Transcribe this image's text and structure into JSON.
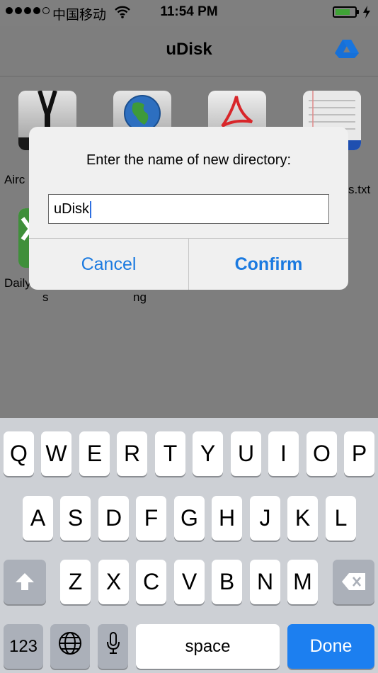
{
  "status_bar": {
    "carrier": "中国移动",
    "time": "11:54 PM",
    "signal_dots": 5,
    "signal_filled": 4,
    "battery_level": 0.75,
    "battery_color": "#3fa336"
  },
  "navbar": {
    "title": "uDisk",
    "drive_icon": "google-drive-icon",
    "accent": "#1b7ae0"
  },
  "files": {
    "row1": [
      {
        "icon": "zip-archive-icon",
        "name": "Airc"
      },
      {
        "icon": "globe-icon",
        "name": ""
      },
      {
        "icon": "pdf-icon",
        "name": ""
      },
      {
        "icon": "text-file-icon",
        "name": "s.txt"
      }
    ],
    "row2": [
      {
        "icon": "excel-icon",
        "name": "Daily"
      },
      {
        "name_line2": "s"
      },
      {
        "name_line2": "ng"
      }
    ]
  },
  "dialog": {
    "message": "Enter the name of new directory:",
    "input_value": "uDisk",
    "cancel_label": "Cancel",
    "confirm_label": "Confirm"
  },
  "keyboard": {
    "row1": [
      "Q",
      "W",
      "E",
      "R",
      "T",
      "Y",
      "U",
      "I",
      "O",
      "P"
    ],
    "row2": [
      "A",
      "S",
      "D",
      "F",
      "G",
      "H",
      "J",
      "K",
      "L"
    ],
    "row3": [
      "Z",
      "X",
      "C",
      "V",
      "B",
      "N",
      "M"
    ],
    "shift_icon": "shift-arrow-icon",
    "delete_icon": "backspace-icon",
    "numbers_label": "123",
    "globe_icon": "globe-icon",
    "mic_icon": "microphone-icon",
    "space_label": "space",
    "done_label": "Done",
    "done_color": "#1c7ff0"
  }
}
